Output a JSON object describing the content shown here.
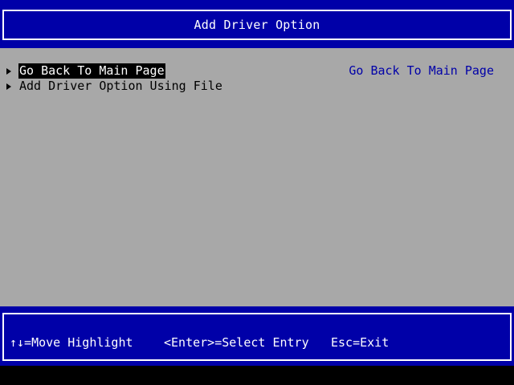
{
  "header": {
    "title": "Add Driver Option"
  },
  "menu": {
    "items": [
      {
        "label": "Go Back To Main Page",
        "selected": true
      },
      {
        "label": "Add Driver Option Using File",
        "selected": false
      }
    ]
  },
  "help": {
    "text": "Go Back To Main Page"
  },
  "footer": {
    "move_hint": "↑↓=Move Highlight",
    "select_hint": "<Enter>=Select Entry",
    "exit_hint": "Esc=Exit"
  },
  "colors": {
    "bar_blue": "#0000a8",
    "body_gray": "#a8a8a8",
    "help_text_blue": "#0000a8",
    "highlight_bg": "#000000",
    "highlight_fg": "#ffffff"
  }
}
